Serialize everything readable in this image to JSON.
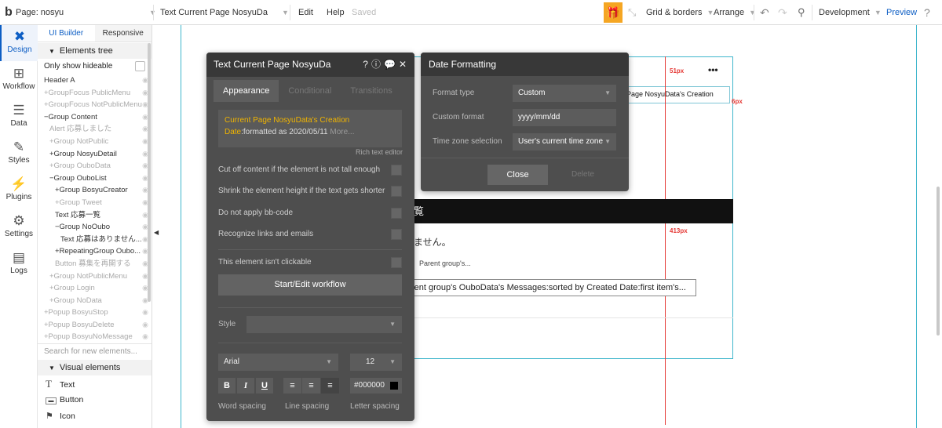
{
  "topbar": {
    "logo": "b",
    "page_label": "Page: nosyu",
    "element_label": "Text Current Page NosyuDa",
    "edit": "Edit",
    "help": "Help",
    "saved": "Saved",
    "grid_borders": "Grid & borders",
    "arrange": "Arrange",
    "development": "Development",
    "preview": "Preview"
  },
  "rail": [
    {
      "label": "Design",
      "icon": "design-icon"
    },
    {
      "label": "Workflow",
      "icon": "workflow-icon"
    },
    {
      "label": "Data",
      "icon": "database-icon"
    },
    {
      "label": "Styles",
      "icon": "brush-icon"
    },
    {
      "label": "Plugins",
      "icon": "plug-icon"
    },
    {
      "label": "Settings",
      "icon": "gear-icon"
    },
    {
      "label": "Logs",
      "icon": "document-icon"
    }
  ],
  "tree": {
    "tab_ui_builder": "UI Builder",
    "tab_responsive": "Responsive",
    "elements_tree": "Elements tree",
    "only_hideable": "Only show hideable",
    "items": [
      {
        "text": "Header A",
        "dim": false
      },
      {
        "text": "+GroupFocus PublicMenu",
        "dim": true
      },
      {
        "text": "+GroupFocus NotPublicMenu",
        "dim": true
      },
      {
        "text": "−Group Content",
        "dim": false
      },
      {
        "text": "Alert 応募しました",
        "dim": true
      },
      {
        "text": "+Group NotPublic",
        "dim": true
      },
      {
        "text": "+Group NosyuDetail",
        "dim": false
      },
      {
        "text": "+Group OuboData",
        "dim": true
      },
      {
        "text": "−Group OuboList",
        "dim": false
      },
      {
        "text": "+Group BosyuCreator",
        "dim": false
      },
      {
        "text": "+Group Tweet",
        "dim": true
      },
      {
        "text": "Text 応募一覧",
        "dim": false
      },
      {
        "text": "−Group NoOubo",
        "dim": false
      },
      {
        "text": "Text 応募はありません...",
        "dim": false
      },
      {
        "text": "+RepeatingGroup Oubo...",
        "dim": false
      },
      {
        "text": "Button 募集を再開する",
        "dim": true
      },
      {
        "text": "+Group NotPublicMenu",
        "dim": true
      },
      {
        "text": "+Group Login",
        "dim": true
      },
      {
        "text": "+Group NoData",
        "dim": true
      },
      {
        "text": "+Popup BosyuStop",
        "dim": true
      },
      {
        "text": "+Popup BosyuDelete",
        "dim": true
      },
      {
        "text": "+Popup BosyuNoMessage",
        "dim": true
      }
    ],
    "search_placeholder": "Search for new elements...",
    "visual_elements": "Visual elements",
    "visual_items": [
      {
        "text": "Text",
        "icon": "text-icon"
      },
      {
        "text": "Button",
        "icon": "button-icon"
      },
      {
        "text": "Icon",
        "icon": "flag-icon"
      }
    ]
  },
  "prop": {
    "title": "Text Current Page NosyuDa",
    "tabs": [
      "Appearance",
      "Conditional",
      "Transitions"
    ],
    "rich_text_dynamic": "Current Page NosyuData's Creation Date",
    "rich_text_rest": ":formatted as 2020/05/11",
    "rich_text_more": "More...",
    "rich_text_editor": "Rich text editor",
    "checks": [
      "Cut off content if the element is not tall enough",
      "Shrink the element height if the text gets shorter",
      "Do not apply bb-code",
      "Recognize links and emails",
      "This element isn't clickable"
    ],
    "workflow_button": "Start/Edit workflow",
    "style_label": "Style",
    "font": "Arial",
    "font_size": "12",
    "bold": "B",
    "italic": "I",
    "underline": "U",
    "color": "#000000",
    "word_spacing": "Word spacing",
    "line_spacing": "Line spacing",
    "letter_spacing": "Letter spacing"
  },
  "datefmt": {
    "title": "Date Formatting",
    "format_type_label": "Format type",
    "format_type_value": "Custom",
    "custom_format_label": "Custom format",
    "custom_format_value": "yyyy/mm/dd",
    "tz_label": "Time zone selection",
    "tz_value": "User's current time zone",
    "close": "Close",
    "delete": "Delete"
  },
  "canvas": {
    "text_element": "t Page NosyuData's Creation",
    "more_dots": "•••",
    "label_51": "51px",
    "label_6": "6px",
    "label_413": "413px",
    "black_bar_char": "覧",
    "no_oubo_text": "ません。",
    "parent_group": "Parent group's...",
    "rg_text": "rent group's OuboData's Messages:sorted by Created Date:first item's..."
  }
}
